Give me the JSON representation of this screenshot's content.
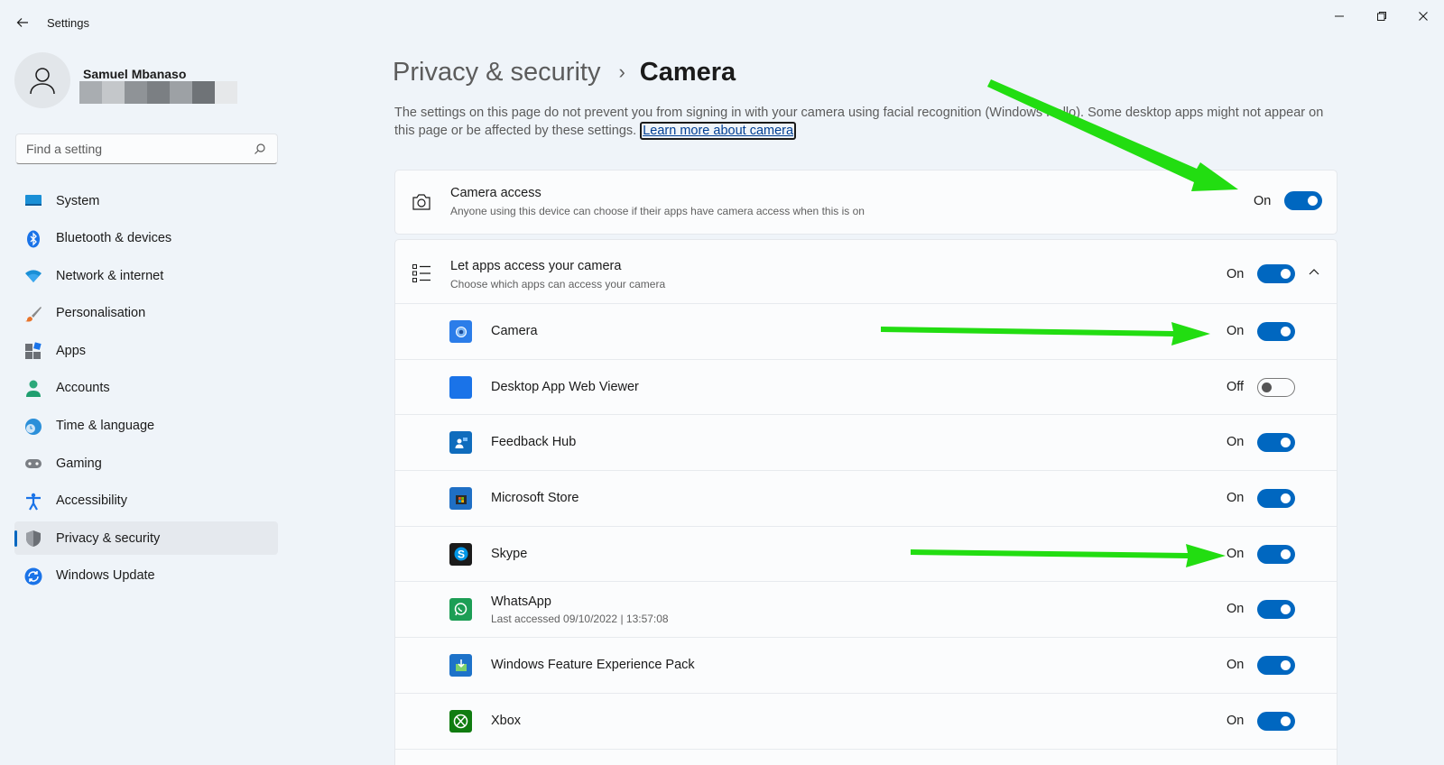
{
  "window": {
    "title": "Settings",
    "back_icon": "arrow-left-icon",
    "controls": [
      "minimize-icon",
      "restore-icon",
      "close-icon"
    ]
  },
  "profile": {
    "name": "Samuel Mbanaso",
    "email_obscured": true
  },
  "search": {
    "placeholder": "Find a setting",
    "value": ""
  },
  "sidebar": {
    "items": [
      {
        "label": "System",
        "icon": "monitor-icon",
        "active": false
      },
      {
        "label": "Bluetooth & devices",
        "icon": "bluetooth-icon",
        "active": false
      },
      {
        "label": "Network & internet",
        "icon": "wifi-icon",
        "active": false
      },
      {
        "label": "Personalisation",
        "icon": "paintbrush-icon",
        "active": false
      },
      {
        "label": "Apps",
        "icon": "apps-icon",
        "active": false
      },
      {
        "label": "Accounts",
        "icon": "person-icon",
        "active": false
      },
      {
        "label": "Time & language",
        "icon": "clock-globe-icon",
        "active": false
      },
      {
        "label": "Gaming",
        "icon": "gamepad-icon",
        "active": false
      },
      {
        "label": "Accessibility",
        "icon": "accessibility-icon",
        "active": false
      },
      {
        "label": "Privacy & security",
        "icon": "shield-icon",
        "active": true
      },
      {
        "label": "Windows Update",
        "icon": "update-icon",
        "active": false
      }
    ]
  },
  "breadcrumb": {
    "parent": "Privacy & security",
    "separator": "›",
    "current": "Camera"
  },
  "description": {
    "text": "The settings on this page do not prevent you from signing in with your camera using facial recognition (Windows Hello). Some desktop apps might not appear on this page or be affected by these settings.",
    "link": "Learn more about camera"
  },
  "camera_access": {
    "title": "Camera access",
    "subtitle": "Anyone using this device can choose if their apps have camera access when this is on",
    "state": "On",
    "on": true
  },
  "app_access": {
    "title": "Let apps access your camera",
    "subtitle": "Choose which apps can access your camera",
    "state": "On",
    "on": true,
    "expanded": true,
    "apps": [
      {
        "name": "Camera",
        "detail": "",
        "state": "On",
        "on": true,
        "icon": "camera-app-icon",
        "color": "#2b7de9"
      },
      {
        "name": "Desktop App Web Viewer",
        "detail": "",
        "state": "Off",
        "on": false,
        "icon": "web-viewer-icon",
        "color": "#1a73e8"
      },
      {
        "name": "Feedback Hub",
        "detail": "",
        "state": "On",
        "on": true,
        "icon": "feedback-hub-icon",
        "color": "#0f6cbd"
      },
      {
        "name": "Microsoft Store",
        "detail": "",
        "state": "On",
        "on": true,
        "icon": "store-icon",
        "color": "#1f6fc5"
      },
      {
        "name": "Skype",
        "detail": "",
        "state": "On",
        "on": true,
        "icon": "skype-icon",
        "color": "#1b1b1b"
      },
      {
        "name": "WhatsApp",
        "detail": "Last accessed 09/10/2022 | 13:57:08",
        "state": "On",
        "on": true,
        "icon": "whatsapp-icon",
        "color": "#1c9e55"
      },
      {
        "name": "Windows Feature Experience Pack",
        "detail": "",
        "state": "On",
        "on": true,
        "icon": "feature-pack-icon",
        "color": "#1d72c9"
      },
      {
        "name": "Xbox",
        "detail": "",
        "state": "On",
        "on": true,
        "icon": "xbox-icon",
        "color": "#107c10"
      }
    ]
  },
  "colors": {
    "accent": "#0067c0",
    "annotation_arrow": "#22dd11"
  }
}
